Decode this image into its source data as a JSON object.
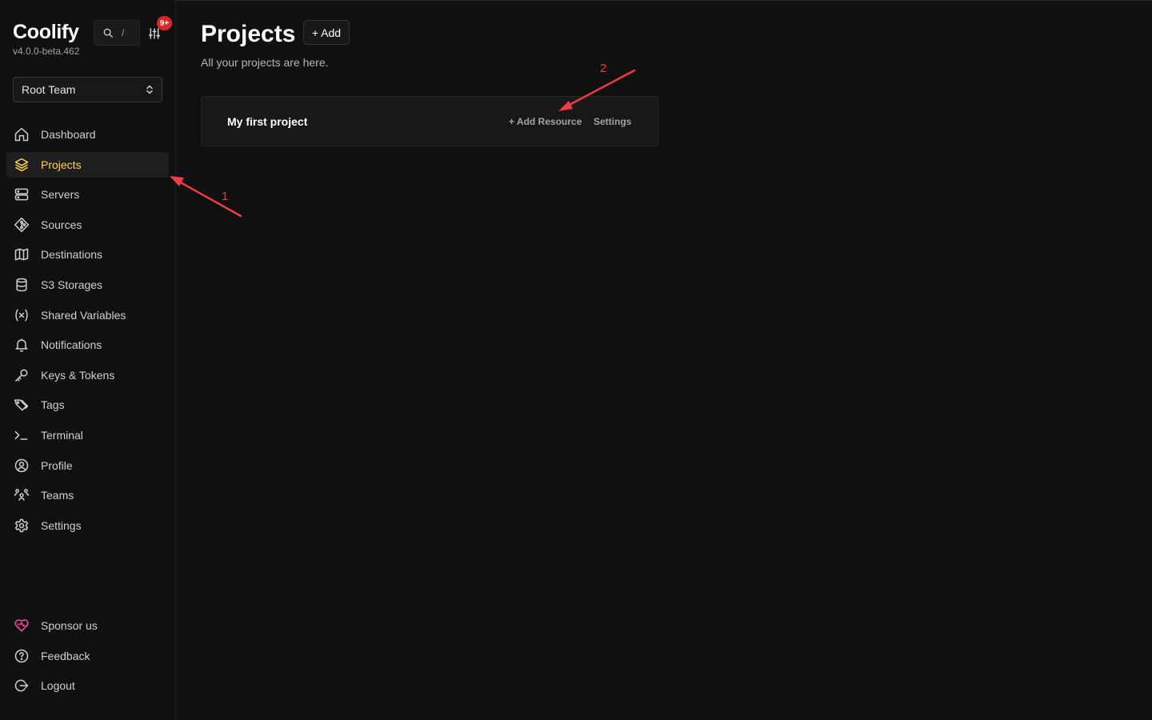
{
  "app": {
    "name": "Coolify",
    "version": "v4.0.0-beta.462"
  },
  "search": {
    "shortcut": "/"
  },
  "notifications_badge": "9+",
  "team_select": {
    "value": "Root Team"
  },
  "sidebar": {
    "items": [
      {
        "label": "Dashboard",
        "icon": "home-icon",
        "active": false
      },
      {
        "label": "Projects",
        "icon": "layers-icon",
        "active": true
      },
      {
        "label": "Servers",
        "icon": "server-icon",
        "active": false
      },
      {
        "label": "Sources",
        "icon": "git-icon",
        "active": false
      },
      {
        "label": "Destinations",
        "icon": "map-icon",
        "active": false
      },
      {
        "label": "S3 Storages",
        "icon": "database-icon",
        "active": false
      },
      {
        "label": "Shared Variables",
        "icon": "variable-icon",
        "active": false
      },
      {
        "label": "Notifications",
        "icon": "bell-icon",
        "active": false
      },
      {
        "label": "Keys & Tokens",
        "icon": "key-icon",
        "active": false
      },
      {
        "label": "Tags",
        "icon": "tag-icon",
        "active": false
      },
      {
        "label": "Terminal",
        "icon": "terminal-icon",
        "active": false
      },
      {
        "label": "Profile",
        "icon": "user-circle-icon",
        "active": false
      },
      {
        "label": "Teams",
        "icon": "users-icon",
        "active": false
      },
      {
        "label": "Settings",
        "icon": "gear-icon",
        "active": false
      }
    ],
    "bottom_items": [
      {
        "label": "Sponsor us",
        "icon": "heart-icon"
      },
      {
        "label": "Feedback",
        "icon": "help-circle-icon"
      },
      {
        "label": "Logout",
        "icon": "logout-icon"
      }
    ]
  },
  "main": {
    "title": "Projects",
    "add_label": "+ Add",
    "subtitle": "All your projects are here.",
    "projects": [
      {
        "name": "My first project",
        "add_resource_label": "+ Add Resource",
        "settings_label": "Settings"
      }
    ]
  },
  "annotations": [
    {
      "label": "1"
    },
    {
      "label": "2"
    }
  ],
  "colors": {
    "background": "#101010",
    "active_accent": "#fcd452",
    "badge": "#dc2626",
    "annotation": "#ef3b43",
    "sponsor": "#ec4899"
  }
}
